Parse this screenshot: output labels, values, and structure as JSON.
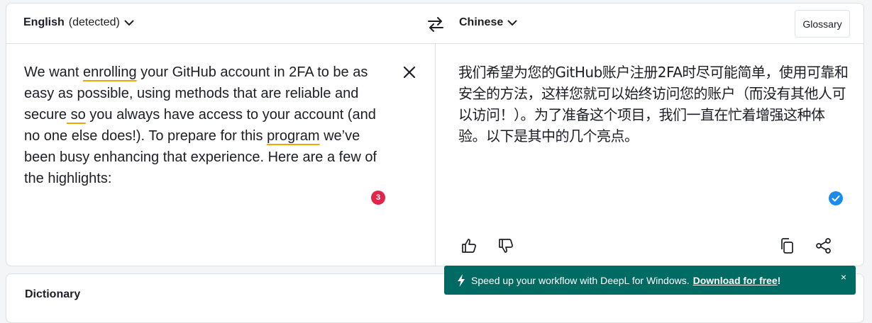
{
  "header": {
    "source_language": "English",
    "source_detected": "(detected)",
    "target_language": "Chinese",
    "glossary_label": "Glossary"
  },
  "source": {
    "segments": [
      {
        "text": "We want ",
        "underline": false
      },
      {
        "text": "enrolling",
        "underline": true
      },
      {
        "text": " your GitHub account in 2FA to be as easy as possible, using methods that are reliable and secure",
        "underline": false
      },
      {
        "text": " so",
        "underline": true
      },
      {
        "text": " you always have access to your account (and no one else does!). To prepare for this ",
        "underline": false
      },
      {
        "text": "program",
        "underline": true
      },
      {
        "text": " we’ve been busy enhancing that experience. Here are a few of the highlights:",
        "underline": false
      }
    ],
    "issue_count": "3"
  },
  "target": {
    "text": "我们希望为您的GitHub账户注册2FA时尽可能简单，使用可靠和安全的方法，这样您就可以始终访问您的账户（而没有其他人可以访问！）。为了准备这个项目，我们一直在忙着增强这种体验。以下是其中的几个亮点。"
  },
  "colors": {
    "accent_underline": "#f0a500",
    "badge": "#e0264b",
    "check": "#1a8cec",
    "promo_bg": "#006b62"
  },
  "dictionary": {
    "title": "Dictionary"
  },
  "promo": {
    "message": "Speed up your workflow with DeepL for Windows.",
    "link": "Download for free",
    "suffix": "!",
    "close": "×"
  }
}
